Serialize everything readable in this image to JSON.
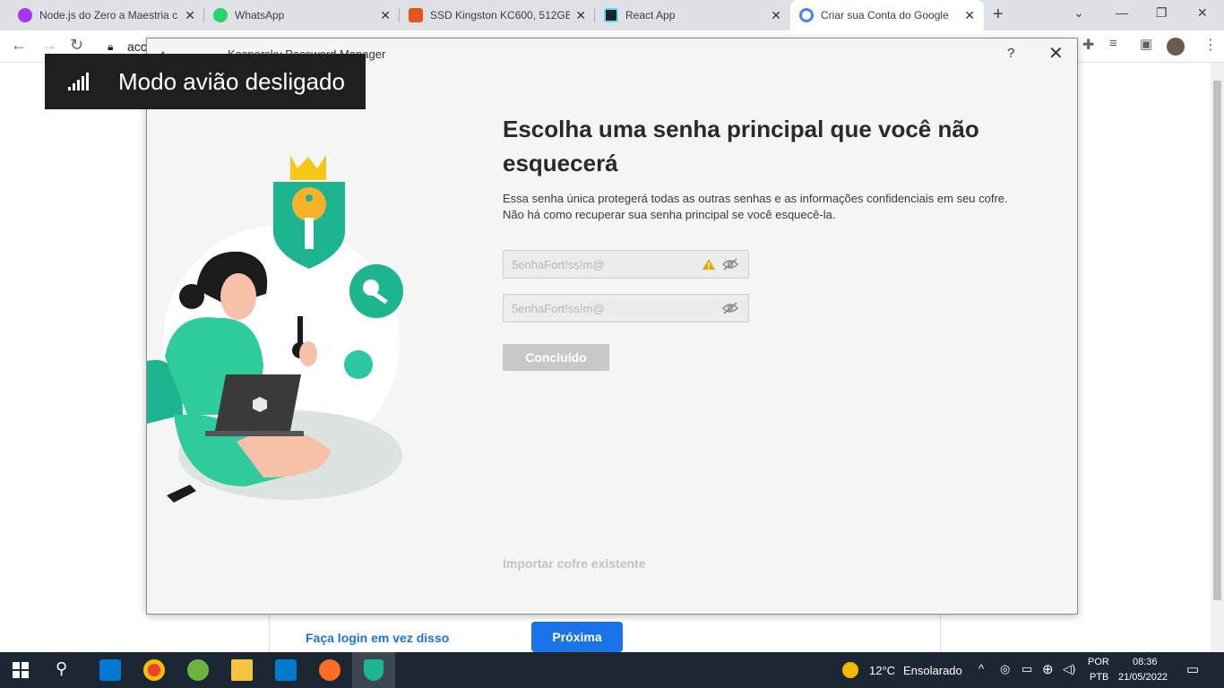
{
  "browser": {
    "tabs": [
      {
        "title": "Node.js do Zero a Maestria c",
        "icon": "udemy-icon",
        "color": "#a435f0"
      },
      {
        "title": "WhatsApp",
        "icon": "whatsapp-icon",
        "color": "#25d366"
      },
      {
        "title": "SSD Kingston KC600, 512GB,",
        "icon": "store-icon",
        "color": "#e8541e"
      },
      {
        "title": "React App",
        "icon": "react-icon",
        "color": "#61dafb"
      },
      {
        "title": "Criar sua Conta do Google",
        "icon": "google-icon",
        "color": "#4285f4",
        "active": true
      }
    ],
    "address": "acc"
  },
  "toast": {
    "message": "Modo avião desligado"
  },
  "dialog": {
    "app_title": "Kaspersky Password Manager",
    "heading": "Escolha uma senha principal que você não esquecerá",
    "description_line1": "Essa senha única protegerá todas as outras senhas e as informações confidenciais em seu cofre.",
    "description_line2": "Não há como recuperar sua senha principal se você esquecê-la.",
    "password_placeholder": "5enhaFort!ss!m@",
    "confirm_placeholder": "5enhaFort!ss!m@",
    "done_label": "Concluído",
    "import_label": "Importar cofre existente",
    "accent_color": "#1db58f"
  },
  "background_page": {
    "login_link": "Faça login em vez disso",
    "next_label": "Próxima"
  },
  "taskbar": {
    "weather_temp": "12°C",
    "weather_desc": "Ensolarado",
    "lang_top": "POR",
    "lang_bottom": "PTB",
    "time": "08:36",
    "date": "21/05/2022"
  }
}
